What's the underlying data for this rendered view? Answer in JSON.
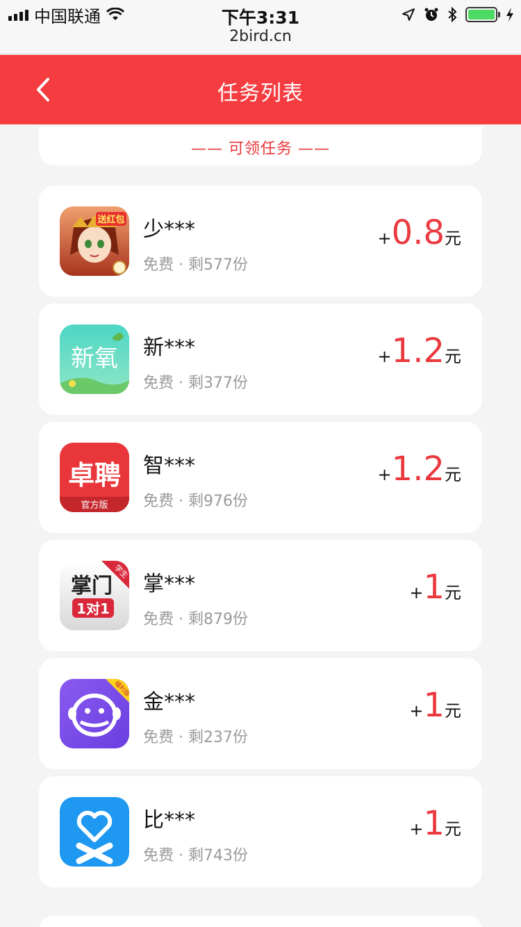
{
  "status_bar": {
    "carrier": "中国联通",
    "time": "下午3:31",
    "url": "2bird.cn"
  },
  "nav": {
    "title": "任务列表"
  },
  "section": {
    "title": "—— 可领任务 ——"
  },
  "tasks": [
    {
      "name": "少***",
      "meta": "免费 · 剩577份",
      "reward_plus": "+",
      "reward_amount": "0.8",
      "reward_unit": "元",
      "icon": "game-character-icon",
      "icon_badge": "送红包"
    },
    {
      "name": "新***",
      "meta": "免费 · 剩377份",
      "reward_plus": "+",
      "reward_amount": "1.2",
      "reward_unit": "元",
      "icon": "xinyang-app-icon",
      "icon_text": "新氧"
    },
    {
      "name": "智***",
      "meta": "免费 · 剩976份",
      "reward_plus": "+",
      "reward_amount": "1.2",
      "reward_unit": "元",
      "icon": "zhaopin-app-icon",
      "icon_text": "卓聘",
      "icon_sub": "官方版"
    },
    {
      "name": "掌***",
      "meta": "免费 · 剩879份",
      "reward_plus": "+",
      "reward_amount": "1",
      "reward_unit": "元",
      "icon": "zhangmen-app-icon",
      "icon_text": "掌门",
      "icon_sub": "1对1",
      "icon_badge": "学生"
    },
    {
      "name": "金***",
      "meta": "免费 · 剩237份",
      "reward_plus": "+",
      "reward_amount": "1",
      "reward_unit": "元",
      "icon": "monkey-app-icon",
      "icon_badge": "福利版"
    },
    {
      "name": "比***",
      "meta": "免费 · 剩743份",
      "reward_plus": "+",
      "reward_amount": "1",
      "reward_unit": "元",
      "icon": "heart-app-icon"
    }
  ],
  "colors": {
    "brand_red": "#f53c40",
    "reward_red": "#ea3a40"
  }
}
